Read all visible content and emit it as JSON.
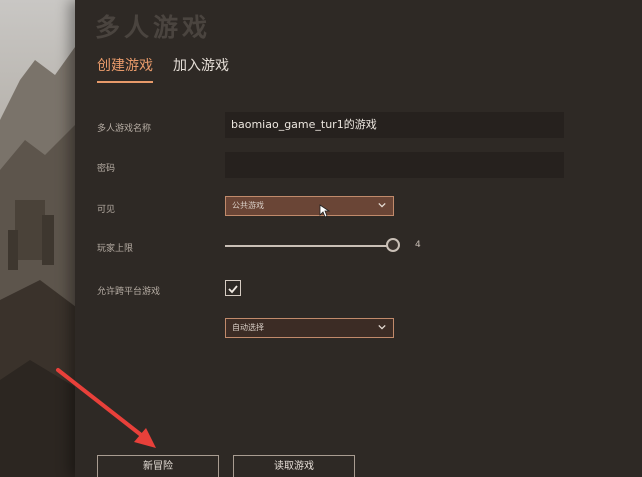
{
  "panel": {
    "title": "多人游戏"
  },
  "tabs": [
    {
      "label": "创建游戏",
      "active": true
    },
    {
      "label": "加入游戏",
      "active": false
    }
  ],
  "form": {
    "name_label": "多人游戏名称",
    "name_value": "baomiao_game_tur1的游戏",
    "password_label": "密码",
    "password_value": "",
    "visibility_label": "可见",
    "visibility_value": "公共游戏",
    "max_players_label": "玩家上限",
    "max_players_value": "4",
    "max_players_fraction": 1.0,
    "crossplay_label": "允许跨平台游戏",
    "crossplay_checked": true,
    "region_value": "自动选择"
  },
  "buttons": {
    "new_adventure": "新冒险",
    "load_game": "读取游戏"
  },
  "colors": {
    "accent": "#e89a6a",
    "dropdown_bg": "#6a4536",
    "annotation": "#e8403a"
  }
}
